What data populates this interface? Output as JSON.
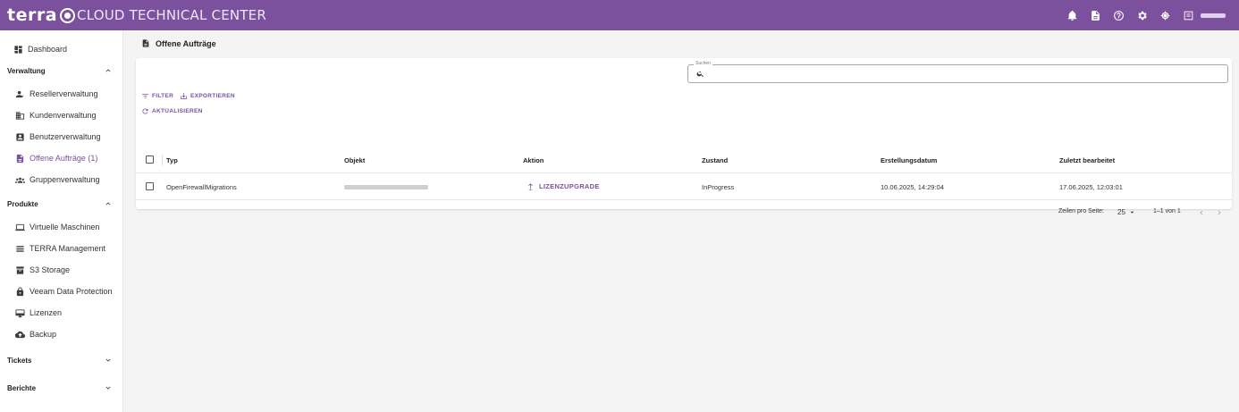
{
  "colors": {
    "brand": "#7b519d",
    "background": "#f4f4f5"
  },
  "header": {
    "logo_text": "terra",
    "logo_subtitle": "CLOUD TECHNICAL CENTER",
    "icons": [
      "bell-icon",
      "document-icon",
      "help-icon",
      "settings-icon",
      "target-icon",
      "user-badge-icon"
    ]
  },
  "sidebar": {
    "dashboard": "Dashboard",
    "sections": {
      "verwaltung": "Verwaltung",
      "produkte": "Produkte",
      "tickets": "Tickets",
      "berichte": "Berichte"
    },
    "verwaltung_items": [
      "Resellerverwaltung",
      "Kundenverwaltung",
      "Benutzerverwaltung",
      "Offene Aufträge (1)",
      "Gruppenverwaltung"
    ],
    "produkte_items": [
      "Virtuelle Maschinen",
      "TERRA Management",
      "S3 Storage",
      "Veeam Data Protection",
      "Lizenzen",
      "Backup"
    ]
  },
  "main": {
    "title": "Offene Aufträge",
    "search_label": "Suchen",
    "buttons": {
      "filter": "FILTER",
      "export": "EXPORTIEREN",
      "refresh": "AKTUALISIEREN"
    },
    "table": {
      "columns": [
        "Typ",
        "Objekt",
        "Aktion",
        "Zustand",
        "Erstellungsdatum",
        "Zuletzt bearbeitet"
      ],
      "rows": [
        {
          "typ": "OpenFirewallMigrations",
          "aktion": "LIZENZUPGRADE",
          "zustand": "InProgress",
          "erstellungsdatum": "10.06.2025, 14:29:04",
          "zuletzt": "17.06.2025, 12:03:01"
        }
      ]
    },
    "pager": {
      "rows_label": "Zeilen pro Seite:",
      "rows_value": "25",
      "range": "1–1 von 1"
    }
  }
}
